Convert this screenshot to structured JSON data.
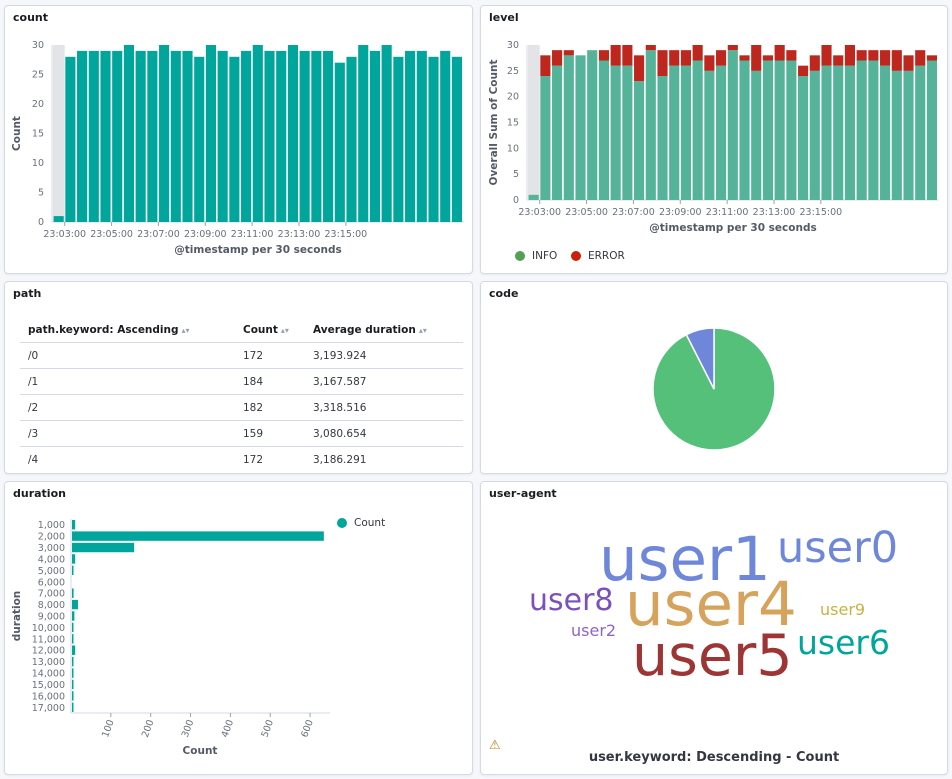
{
  "panels": {
    "count": {
      "title": "count",
      "chart_data": {
        "type": "bar",
        "title": "",
        "xlabel": "@timestamp per 30 seconds",
        "ylabel": "Count",
        "ylim": [
          0,
          30
        ],
        "yticks": [
          0,
          5,
          10,
          15,
          20,
          25,
          30
        ],
        "xtick_labels": [
          "23:03:00",
          "23:05:00",
          "23:07:00",
          "23:09:00",
          "23:11:00",
          "23:13:00",
          "23:15:00"
        ],
        "partial_bucket_shading": "first bucket",
        "values": [
          1,
          28,
          29,
          29,
          29,
          29,
          30,
          29,
          29,
          30,
          29,
          29,
          28,
          30,
          29,
          28,
          29,
          30,
          29,
          29,
          30,
          29,
          29,
          29,
          27,
          28,
          30,
          29,
          30,
          28,
          29,
          29,
          28,
          29,
          28
        ],
        "color": "#00a69b"
      }
    },
    "level": {
      "title": "level",
      "chart_data": {
        "type": "bar",
        "stacked": true,
        "title": "",
        "xlabel": "@timestamp per 30 seconds",
        "ylabel": "Overall Sum of Count",
        "ylim": [
          0,
          30
        ],
        "yticks": [
          0,
          5,
          10,
          15,
          20,
          25,
          30
        ],
        "xtick_labels": [
          "23:03:00",
          "23:05:00",
          "23:07:00",
          "23:09:00",
          "23:11:00",
          "23:13:00",
          "23:15:00"
        ],
        "legend_position": "bottom-left",
        "series": [
          {
            "name": "INFO",
            "color": "#54b399",
            "values": [
              1,
              24,
              26,
              28,
              28,
              29,
              27,
              26,
              26,
              23,
              29,
              24,
              26,
              26,
              27,
              25,
              26,
              29,
              27,
              25,
              27,
              27,
              27,
              24,
              25,
              26,
              26,
              26,
              27,
              27,
              26,
              25,
              25,
              26,
              27
            ]
          },
          {
            "name": "ERROR",
            "color": "#bd271e",
            "values": [
              0,
              4,
              3,
              1,
              0,
              0,
              2,
              4,
              4,
              5,
              1,
              5,
              3,
              3,
              3,
              3,
              3,
              1,
              1,
              5,
              1,
              3,
              2,
              2,
              3,
              4,
              2,
              4,
              2,
              2,
              3,
              4,
              3,
              3,
              1
            ]
          }
        ]
      }
    },
    "path": {
      "title": "path",
      "columns": [
        "path.keyword: Ascending",
        "Count",
        "Average duration"
      ],
      "rows": [
        {
          "path": "/0",
          "count": "172",
          "avg": "3,193.924"
        },
        {
          "path": "/1",
          "count": "184",
          "avg": "3,167.587"
        },
        {
          "path": "/2",
          "count": "182",
          "avg": "3,318.516"
        },
        {
          "path": "/3",
          "count": "159",
          "avg": "3,080.654"
        },
        {
          "path": "/4",
          "count": "172",
          "avg": "3,186.291"
        }
      ],
      "sort_icon": "sort-icon"
    },
    "code": {
      "title": "code",
      "chart_data": {
        "type": "pie",
        "title": "",
        "slices": [
          {
            "value": 92.5,
            "color": "#54c079"
          },
          {
            "value": 7.5,
            "color": "#6f87d8"
          }
        ]
      }
    },
    "duration": {
      "title": "duration",
      "chart_data": {
        "type": "bar",
        "orientation": "horizontal",
        "title": "",
        "xlabel": "Count",
        "ylabel": "duration",
        "xlim": [
          0,
          650
        ],
        "xticks": [
          100,
          200,
          300,
          400,
          500,
          600
        ],
        "categories": [
          "1,000",
          "2,000",
          "3,000",
          "4,000",
          "5,000",
          "6,000",
          "7,000",
          "8,000",
          "9,000",
          "10,000",
          "11,000",
          "12,000",
          "13,000",
          "14,000",
          "15,000",
          "16,000",
          "17,000"
        ],
        "series": [
          {
            "name": "Count",
            "color": "#00a69b",
            "values": [
              8,
              632,
              156,
              8,
              2,
              0,
              4,
              15,
              6,
              3,
              2,
              8,
              1,
              1,
              2,
              2,
              2
            ]
          }
        ],
        "legend_position": "top-right"
      }
    },
    "useragent": {
      "title": "user-agent",
      "caption": "user.keyword: Descending - Count",
      "warning_icon": "warning-icon",
      "warning_glyph": "⚠",
      "words": [
        {
          "text": "user1",
          "color": "#6f87d8"
        },
        {
          "text": "user0",
          "color": "#6f87d8"
        },
        {
          "text": "user8",
          "color": "#7c4fbd"
        },
        {
          "text": "user4",
          "color": "#d6a35c"
        },
        {
          "text": "user9",
          "color": "#c9b340"
        },
        {
          "text": "user2",
          "color": "#8e64c8"
        },
        {
          "text": "user6",
          "color": "#00a69b"
        },
        {
          "text": "user5",
          "color": "#9d3535"
        }
      ]
    }
  }
}
